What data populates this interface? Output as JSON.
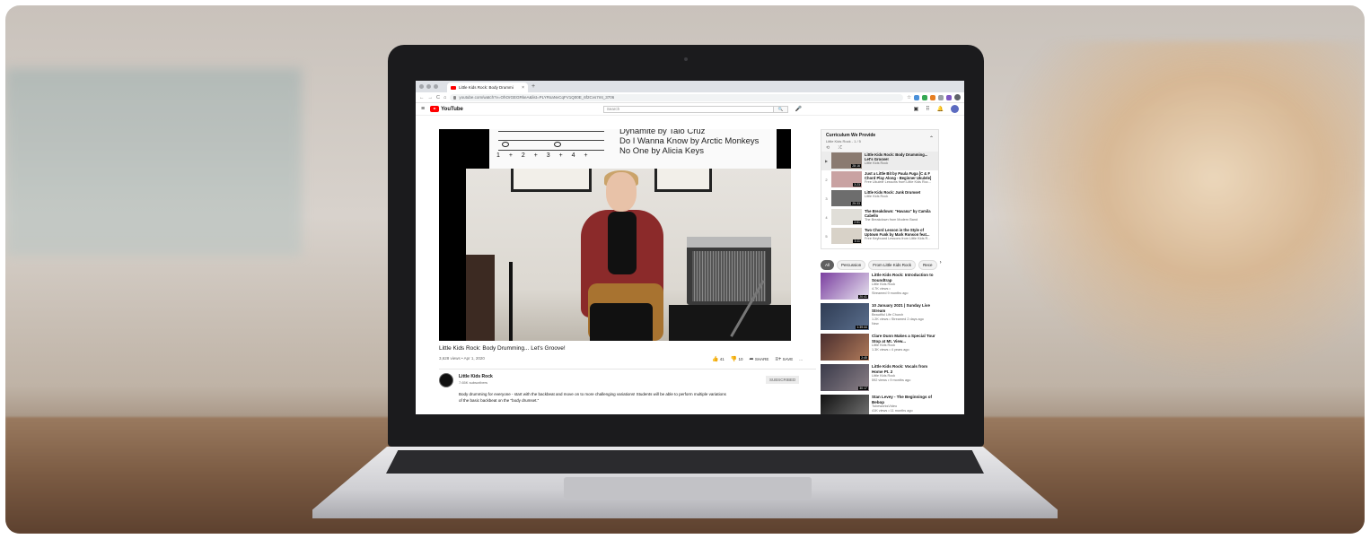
{
  "browser": {
    "tab_title": "Little Kids Rock: Body Drummi",
    "tab_close": "×",
    "new_tab": "+",
    "url": "youtube.com/watch?v=OhOrGEGRkeA&list=PLYRsaNvCqFV1Q00E_6f2Cvs7mt_3706"
  },
  "youtube": {
    "logo": "YouTube",
    "search_placeholder": "Search",
    "search_button": "🔍"
  },
  "video": {
    "songs": [
      "Dynamite by Taio Cruz",
      "Do I Wanna Know by Arctic Monkeys",
      "No One by Alicia Keys"
    ],
    "counts": "1 + 2 + 3 + 4 +",
    "title": "Little Kids Rock: Body Drumming... Let's Groove!",
    "meta": "3,628 views • Apr 1, 2020",
    "likes": "41",
    "dislikes": "10",
    "share": "SHARE",
    "save": "SAVE",
    "more": "...",
    "channel_name": "Little Kids Rock",
    "channel_subs": "7.65K subscribers",
    "subscribe": "SUBSCRIBED",
    "description": "Body drumming for everyone - start with the backbeat and move on to more challenging variations! Students will be able to perform multiple variations of the basic backbeat on the \"body drumset.\""
  },
  "playlist": {
    "title": "Curriculum We Provide",
    "subtitle": "Little Kids Rock - 1 / 5",
    "controls": "⟲ ⤮",
    "items": [
      {
        "idx": "▶",
        "title": "Little Kids Rock: Body Drumming... Let's Groove!",
        "channel": "Little Kids Rock",
        "duration": "28:16"
      },
      {
        "idx": "2",
        "title": "Just a Little Bit by Paula Fuga [C & F Chord Play Along - Beginner Ukulele]",
        "channel": "Free Ukulele Lessons from Little Kids Roc...",
        "duration": "3:23"
      },
      {
        "idx": "3",
        "title": "Little Kids Rock: Junk Drumset",
        "channel": "Little Kids Rock",
        "duration": "25:33"
      },
      {
        "idx": "4",
        "title": "The Breakdown: \"Havana\" by Camila Cabello",
        "channel": "The Breakdown from Modern Band",
        "duration": "2:51"
      },
      {
        "idx": "5",
        "title": "Two Chord Lesson in the Style of Uptown Funk by Mark Ronson feat...",
        "channel": "Free Keyboard Lessons from Little Kids R...",
        "duration": "3:11"
      }
    ]
  },
  "chips": [
    "All",
    "Percussion",
    "From Little Kids Rock",
    "Rece"
  ],
  "recommended": [
    {
      "title": "Little Kids Rock: Introduction to Soundtrap",
      "l1": "Little Kids Rock",
      "l2": "4.7K views •",
      "l3": "Streamed 9 months ago",
      "duration": "20:41"
    },
    {
      "title": "10 January 2021 | Sunday Live Stream",
      "l1": "Beautiful Life Church",
      "l2": "1.2K views • Streamed 2 days ago",
      "l3": "New",
      "duration": "1:39:44"
    },
    {
      "title": "Clare Dunn Makes a Special Tour Stop at Mt. View...",
      "l1": "Little Kids Rock",
      "l2": "1.3K views • 4 years ago",
      "l3": "",
      "duration": "2:45"
    },
    {
      "title": "Little Kids Rock: Vocals from Home Pt. 2",
      "l1": "Little Kids Rock",
      "l2": "592 views • 9 months ago",
      "l3": "",
      "duration": "30:17"
    },
    {
      "title": "Stan Levey - The Beginnings of Bebop",
      "l1": "TubeworksVideo",
      "l2": "41K views • 11 months ago",
      "l3": "",
      "duration": ""
    }
  ],
  "colors": {
    "youtube_red": "#ff0000",
    "jacket": "#8b2a2a"
  }
}
